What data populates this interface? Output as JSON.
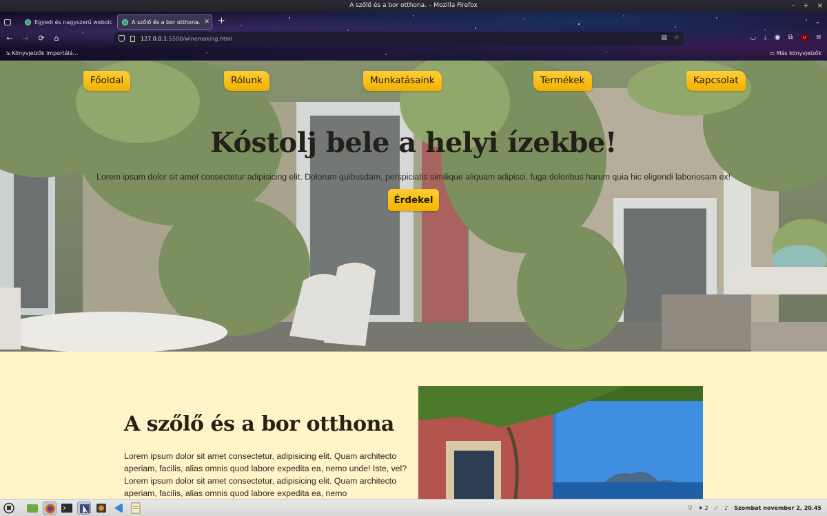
{
  "window": {
    "title": "A szőlő és a bor otthona. – Mozilla Firefox",
    "controls": [
      "–",
      "+",
      "×"
    ]
  },
  "tabs": [
    {
      "label": "Egyedi és nagyszerű webolc",
      "active": false
    },
    {
      "label": "A szőlő és a bor otthona.",
      "active": true
    }
  ],
  "new_tab_glyph": "+",
  "tab_overflow_glyph": "⌄",
  "url": {
    "host": "127.0.0.1",
    "path": ":5500/winemaking.html"
  },
  "nav_glyphs": {
    "back": "←",
    "forward": "→",
    "reload": "⟳",
    "home": "⌂"
  },
  "bookmarks": {
    "left": "Könyvjelzők importálá…",
    "right": "Más könyvjelzők"
  },
  "site": {
    "nav": [
      "Főoldal",
      "Rólunk",
      "Munkatásaink",
      "Termékek",
      "Kapcsolat"
    ],
    "hero": {
      "title": "Kóstolj bele a helyi ízekbe!",
      "text": "Lorem ipsum dolor sit amet consectetur adipisicing elit. Dolorum quibusdam, perspiciatis similique aliquam adipisci, fuga doloribus harum quia hic eligendi laboriosam ex!",
      "button": "Érdekel"
    },
    "about": {
      "title": "A szőlő és a bor otthona",
      "text": "Lorem ipsum dolor sit amet consectetur, adipisicing elit. Quam architecto aperiam, facilis, alias omnis quod labore expedita ea, nemo unde! Iste, vel? Lorem ipsum dolor sit amet consectetur, adipisicing elit. Quam architecto aperiam, facilis, alias omnis quod labore expedita ea, nemo"
    }
  },
  "taskbar": {
    "tray_count": "2",
    "clock": "Szombat november 2, 20.45"
  },
  "colors": {
    "accent": "#f5b300",
    "section_bg": "#fff3c8",
    "text_dark": "#222019"
  }
}
